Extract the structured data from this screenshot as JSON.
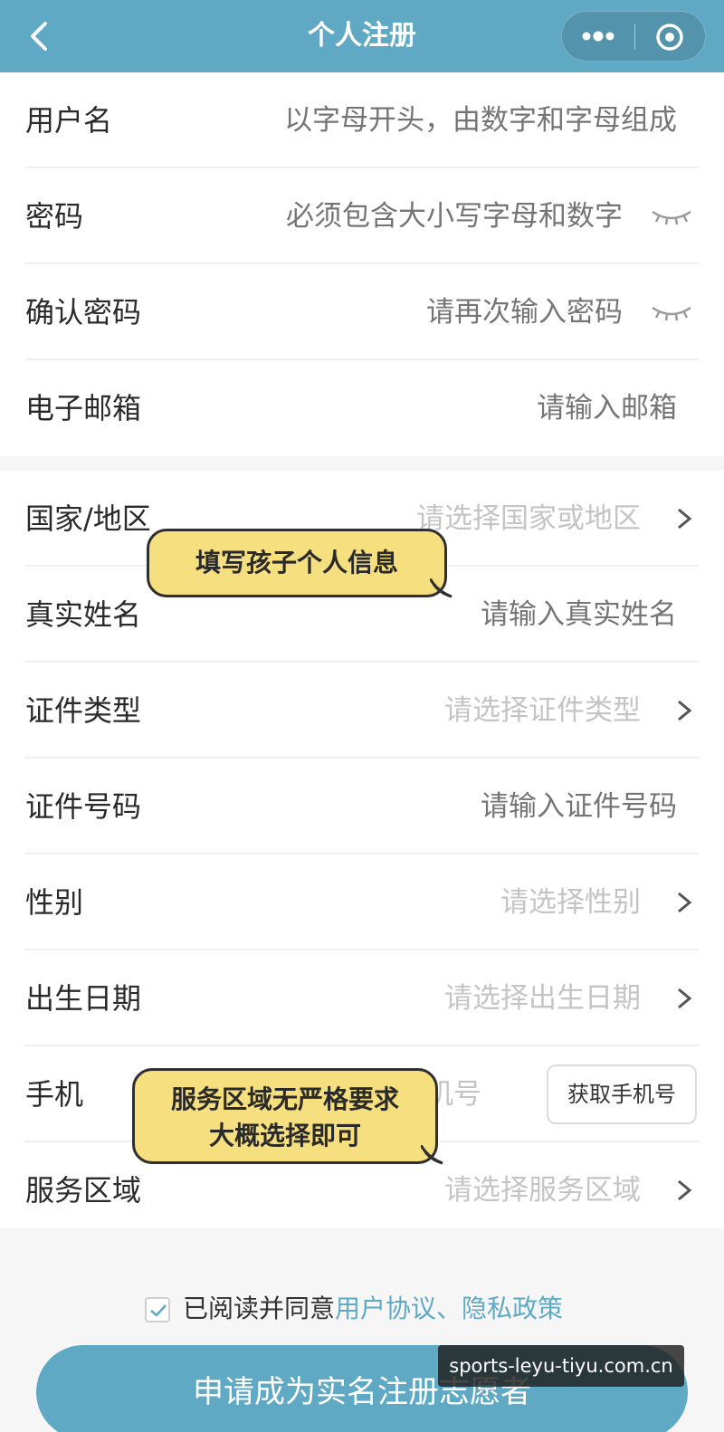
{
  "header": {
    "title": "个人注册"
  },
  "account": [
    {
      "label": "用户名",
      "placeholder": "以字母开头，由数字和字母组成"
    },
    {
      "label": "密码",
      "placeholder": "必须包含大小写字母和数字"
    },
    {
      "label": "确认密码",
      "placeholder": "请再次输入密码"
    },
    {
      "label": "电子邮箱",
      "placeholder": "请输入邮箱"
    }
  ],
  "personal": [
    {
      "label": "国家/地区",
      "placeholder": "请选择国家或地区"
    },
    {
      "label": "真实姓名",
      "placeholder": "请输入真实姓名"
    },
    {
      "label": "证件类型",
      "placeholder": "请选择证件类型"
    },
    {
      "label": "证件号码",
      "placeholder": "请输入证件号码"
    },
    {
      "label": "性别",
      "placeholder": "请选择性别"
    },
    {
      "label": "出生日期",
      "placeholder": "请选择出生日期"
    },
    {
      "label": "手机",
      "placeholder": "机号",
      "button": "获取手机号"
    },
    {
      "label": "服务区域",
      "placeholder": "请选择服务区域"
    }
  ],
  "annotations": {
    "personal_info": "填写孩子个人信息",
    "service_area_line1": "服务区域无严格要求",
    "service_area_line2": "大概选择即可"
  },
  "agreement": {
    "prefix": "已阅读并同意",
    "links": "用户协议、隐私政策",
    "checked": true
  },
  "submit_label": "申请成为实名注册志愿者",
  "watermark": "sports-leyu-tiyu.com.cn",
  "colors": {
    "primary": "#5fa9c4",
    "bubble": "#f5df7e"
  }
}
